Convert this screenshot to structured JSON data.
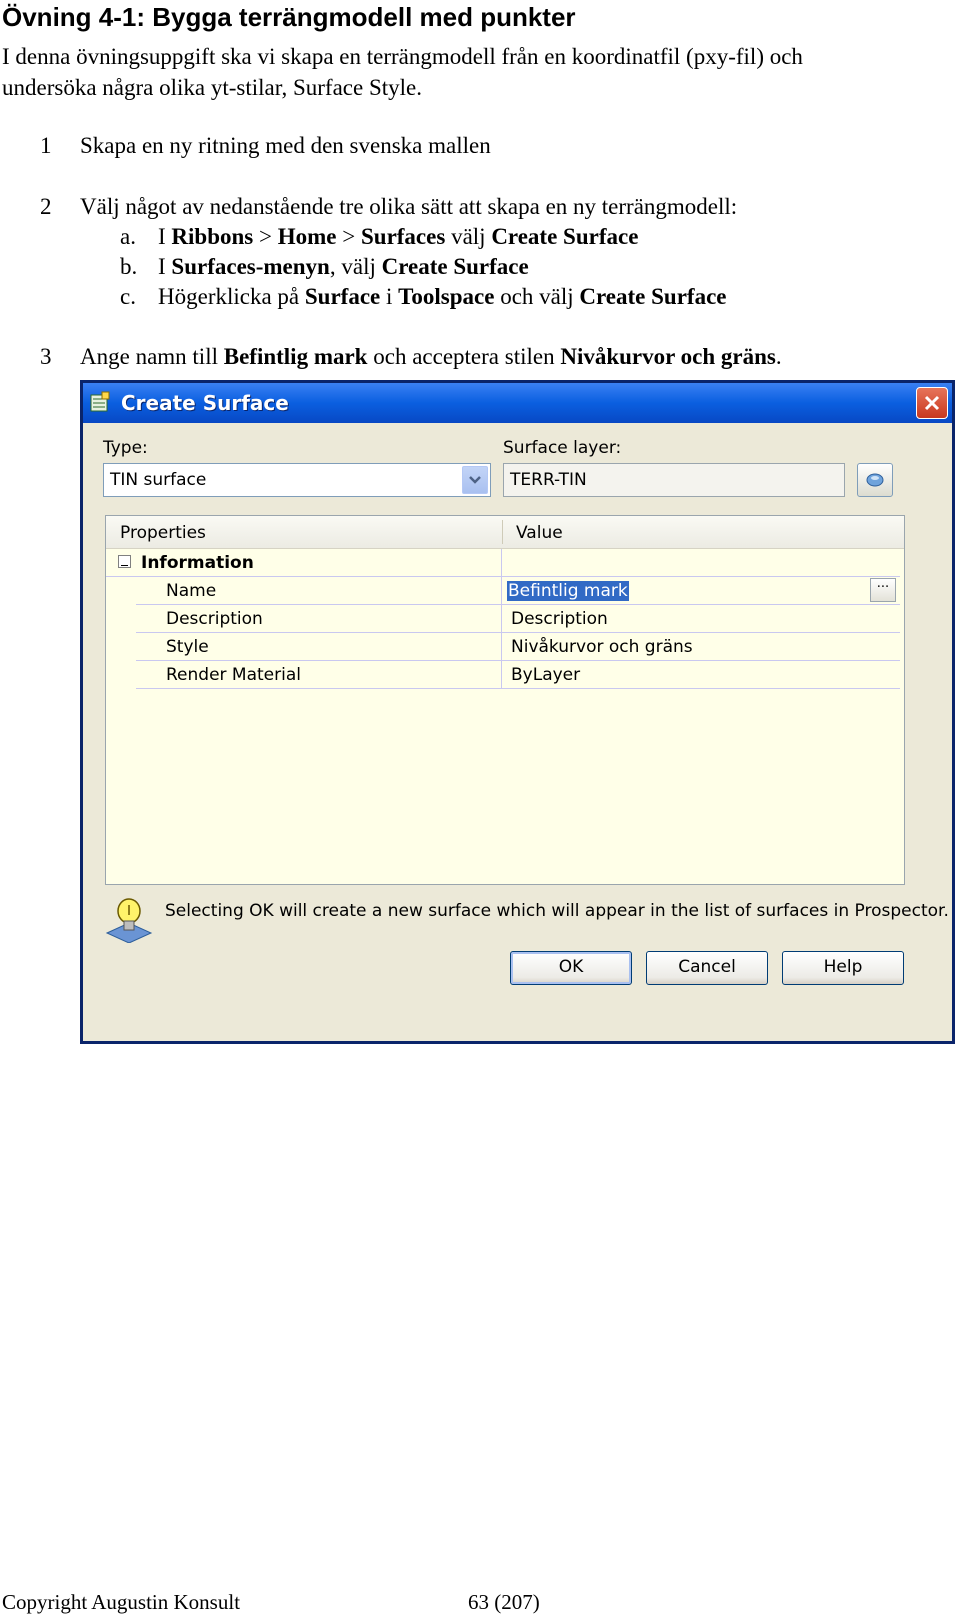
{
  "heading": "Övning 4-1: Bygga terrängmodell med punkter",
  "intro": {
    "line1": "I denna övningsuppgift ska vi skapa en terrängmodell från en koordinatfil (pxy-fil) och",
    "line2": "undersöka några olika yt-stilar, Surface Style."
  },
  "steps": [
    {
      "number": "1",
      "text": "Skapa en ny ritning med den svenska mallen"
    },
    {
      "number": "2",
      "text": "Välj något av nedanstående tre olika sätt att skapa en ny terrängmodell:"
    },
    {
      "number": "3",
      "pre": "Ange namn till ",
      "bold1": "Befintlig mark",
      "mid": " och acceptera stilen ",
      "bold2": "Nivåkurvor och gräns",
      "post": "."
    }
  ],
  "substeps": [
    {
      "letter": "a.",
      "p1": "I ",
      "b1": "Ribbons",
      "p2": " > ",
      "b2": "Home",
      "p3": " > ",
      "b3": "Surfaces",
      "p4": " välj ",
      "b4": "Create Surface"
    },
    {
      "letter": "b.",
      "p1": "I ",
      "b1": "Surfaces-menyn",
      "p2": ", välj ",
      "b2": "Create Surface"
    },
    {
      "letter": "c.",
      "p1": "Högerklicka på ",
      "b1": "Surface",
      "p2": " i ",
      "b2": "Toolspace",
      "p3": " och välj ",
      "b3": "Create Surface"
    }
  ],
  "dialog": {
    "title": "Create Surface",
    "type_label": "Type:",
    "type_value": "TIN surface",
    "layer_label": "Surface layer:",
    "layer_value": "TERR-TIN",
    "grid": {
      "col_properties": "Properties",
      "col_value": "Value",
      "group": "Information",
      "rows": [
        {
          "prop": "Name",
          "value": "Befintlig mark"
        },
        {
          "prop": "Description",
          "value": "Description"
        },
        {
          "prop": "Style",
          "value": "Nivåkurvor och gräns"
        },
        {
          "prop": "Render Material",
          "value": "ByLayer"
        }
      ],
      "ellipsis": "···"
    },
    "hint": "Selecting OK will create a new surface which will appear in the list of surfaces in Prospector.",
    "buttons": {
      "ok": "OK",
      "cancel": "Cancel",
      "help": "Help"
    }
  },
  "footer": {
    "copyright": "Copyright Augustin Konsult",
    "page": "63 (207)"
  },
  "colors": {
    "titlebar": "#0a5fe0",
    "dialog_bg": "#ece9d8",
    "grid_bg": "#ffffe8",
    "selection": "#316ac5"
  }
}
